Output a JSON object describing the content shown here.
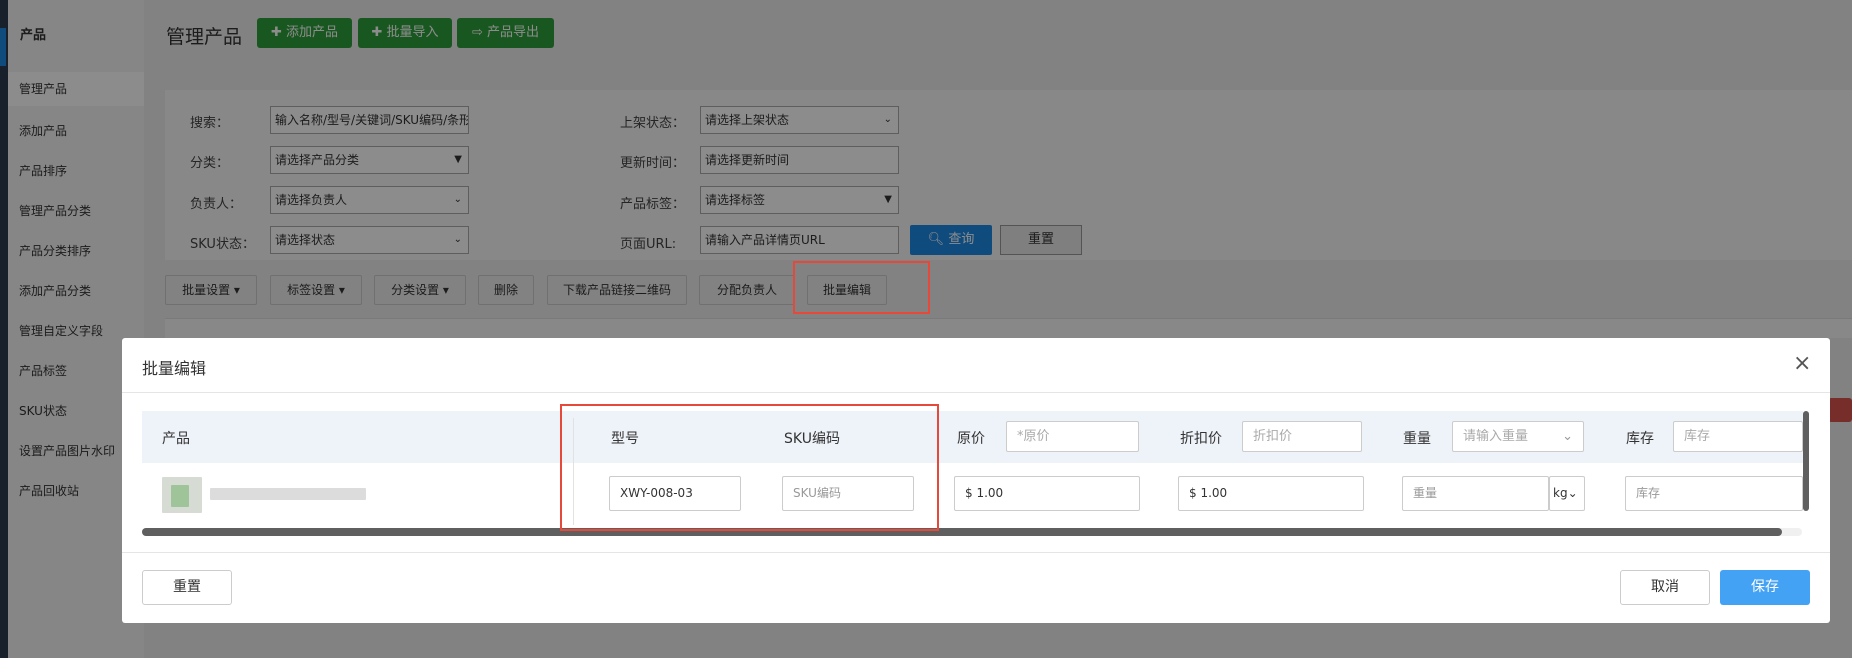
{
  "sidebar": {
    "title": "产品",
    "items": [
      "管理产品",
      "添加产品",
      "产品排序",
      "管理产品分类",
      "产品分类排序",
      "添加产品分类",
      "管理自定义字段",
      "产品标签",
      "SKU状态",
      "设置产品图片水印",
      "产品回收站"
    ]
  },
  "header": {
    "title": "管理产品",
    "add_label": "添加产品",
    "import_label": "批量导入",
    "export_label": "产品导出"
  },
  "search": {
    "keyword_label": "搜索：",
    "keyword_value": "输入名称/型号/关键词/SKU编码/条形",
    "category_label": "分类：",
    "category_value": "请选择产品分类",
    "owner_label": "负责人：",
    "owner_value": "请选择负责人",
    "sku_status_label": "SKU状态：",
    "sku_status_value": "请选择状态",
    "shelf_label": "上架状态：",
    "shelf_value": "请选择上架状态",
    "updated_label": "更新时间：",
    "updated_value": "请选择更新时间",
    "tag_label": "产品标签：",
    "tag_value": "请选择标签",
    "url_label": "页面URL:",
    "url_value": "请输入产品详情页URL",
    "query_label": "查询",
    "reset_label": "重置"
  },
  "toolbar": {
    "batch_settings": "批量设置",
    "tag_settings": "标签设置",
    "category_settings": "分类设置",
    "delete": "删除",
    "download_qr": "下载产品链接二维码",
    "assign_owner": "分配负责人",
    "batch_edit": "批量编辑"
  },
  "modal": {
    "title": "批量编辑",
    "close": "×",
    "columns": {
      "product": "产品",
      "model": "型号",
      "sku": "SKU编码",
      "price": "原价",
      "price_placeholder": "*原价",
      "discount": "折扣价",
      "discount_placeholder": "折扣价",
      "weight": "重量",
      "weight_placeholder": "请输入重量",
      "stock": "库存",
      "stock_placeholder": "库存"
    },
    "row": {
      "model_value": "XWY-008-03",
      "sku_placeholder": "SKU编码",
      "currency": "$",
      "price_value": "1.00",
      "discount_value": "1.00",
      "weight_placeholder": "重量",
      "weight_unit": "kg",
      "stock_placeholder": "库存"
    },
    "reset_label": "重置",
    "cancel_label": "取消",
    "save_label": "保存"
  },
  "colors": {
    "green": "#2e9e3b",
    "blue": "#1e88e5",
    "highlight_red": "#e6483a",
    "save_blue": "#44a2f5"
  }
}
